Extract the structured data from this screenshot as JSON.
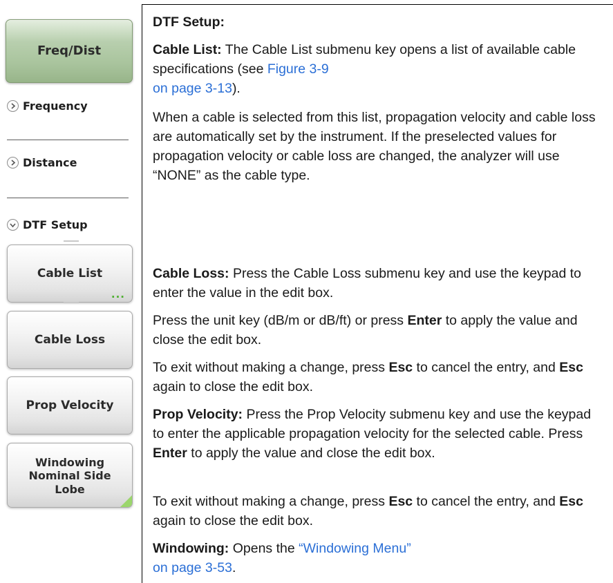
{
  "menu": {
    "main_key": "Freq/Dist",
    "items": [
      {
        "label": "Frequency",
        "icon": "chevron-right-icon"
      },
      {
        "label": "Distance",
        "icon": "chevron-right-icon"
      },
      {
        "label": "DTF Setup",
        "icon": "chevron-down-icon"
      }
    ],
    "submenu_keys": [
      {
        "label": "Cable List",
        "indicator": "..."
      },
      {
        "label": "Cable Loss"
      },
      {
        "label": "Prop Velocity"
      },
      {
        "label_lines": [
          "Windowing",
          "Nominal Side",
          "Lobe"
        ]
      }
    ]
  },
  "content": {
    "heading": "DTF Setup:",
    "cable_list": {
      "term": "Cable List:",
      "text_before_link": " The Cable List submenu key opens a list of available cable specifications (see ",
      "link_line1": "Figure 3-9",
      "link_line2": "on page 3-13",
      "text_after_link": ")."
    },
    "cable_selected": "When a cable is selected from this list, propagation velocity and cable loss are automatically set by the instrument. If the preselected values for propagation velocity or cable loss are changed, the analyzer will use “NONE” as the cable type.",
    "cable_loss": {
      "term": "Cable Loss:",
      "text": " Press the Cable Loss submenu key and use the keypad to enter the value in the edit box."
    },
    "unit_key": {
      "text_before": "Press the unit key (dB/m or dB/ft) or press ",
      "key": "Enter",
      "text_after": " to apply the value and close the edit box."
    },
    "exit_note_1": {
      "part1": "To exit without making a change, press ",
      "key1": "Esc",
      "part2": " to cancel the entry, and ",
      "key2": "Esc",
      "part3": " again to close the edit box."
    },
    "prop_velocity": {
      "term": "Prop Velocity:",
      "text_before": " Press the Prop Velocity submenu key and use the keypad to enter the applicable propagation velocity for the selected cable. Press ",
      "key": "Enter",
      "text_after": " to apply the value and close the edit box."
    },
    "exit_note_2": {
      "part1": "To exit without making a change, press ",
      "key1": "Esc",
      "part2": " to cancel the entry, and ",
      "key2": "Esc",
      "part3": " again to close the edit box."
    },
    "windowing": {
      "term": "Windowing:",
      "text": " Opens the ",
      "link_line1": "“Windowing Menu”",
      "link_line2": "on page 3-53",
      "text_after": "."
    }
  },
  "colors": {
    "link": "#2b6fd6",
    "main_key_green": "#a9c49d",
    "indicator_green": "#4caf2e"
  }
}
